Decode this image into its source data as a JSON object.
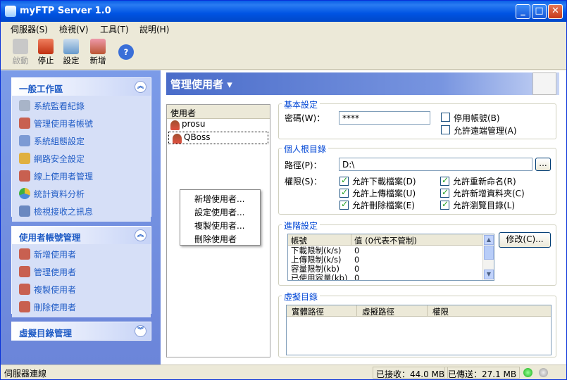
{
  "window": {
    "title": "myFTP Server 1.0"
  },
  "menu": [
    "伺服器(S)",
    "檢視(V)",
    "工具(T)",
    "說明(H)"
  ],
  "toolbar": {
    "start": "啟動",
    "stop": "停止",
    "settings": "設定",
    "add": "新增"
  },
  "sidebar": {
    "general": {
      "title": "一般工作區",
      "items": [
        "系統監看紀錄",
        "管理使用者帳號",
        "系統組態設定",
        "網路安全設定",
        "線上使用者管理",
        "統計資料分析",
        "檢視接收之訊息"
      ]
    },
    "accounts": {
      "title": "使用者帳號管理",
      "items": [
        "新增使用者",
        "管理使用者",
        "複製使用者",
        "刪除使用者"
      ]
    },
    "vdir": {
      "title": "虛擬目錄管理"
    }
  },
  "main": {
    "title": "管理使用者"
  },
  "users": {
    "header": "使用者",
    "list": [
      "prosu",
      "QBoss"
    ],
    "context_menu": [
      "新增使用者...",
      "設定使用者...",
      "複製使用者...",
      "刪除使用者"
    ]
  },
  "basic": {
    "legend": "基本設定",
    "password_label": "密碼(W)：",
    "password_value": "****",
    "disable": "停用帳號(B)",
    "remote": "允許遠端管理(A)"
  },
  "home": {
    "legend": "個人根目錄",
    "path_label": "路徑(P)：",
    "path_value": "D:\\",
    "browse": "...",
    "perm_label": "權限(S)：",
    "perms": [
      {
        "label": "允許下載檔案(D)",
        "checked": true
      },
      {
        "label": "允許重新命名(R)",
        "checked": true
      },
      {
        "label": "允許上傳檔案(U)",
        "checked": true
      },
      {
        "label": "允許新增資料夾(C)",
        "checked": true
      },
      {
        "label": "允許刪除檔案(E)",
        "checked": true
      },
      {
        "label": "允許瀏覽目錄(L)",
        "checked": true
      }
    ]
  },
  "advanced": {
    "legend": "進階設定",
    "col1": "帳號",
    "col2": "值 (0代表不管制)",
    "modify": "修改(C)...",
    "rows": [
      {
        "k": "下載限制(k/s)",
        "v": "0"
      },
      {
        "k": "上傳限制(k/s)",
        "v": "0"
      },
      {
        "k": "容量限制(kb)",
        "v": "0"
      },
      {
        "k": "已使用容量(kb)",
        "v": "0"
      }
    ]
  },
  "virtual": {
    "legend": "虛擬目錄",
    "cols": [
      "實體路徑",
      "虛擬路徑",
      "權限"
    ]
  },
  "status": {
    "state": "伺服器連線",
    "received": "已接收：44.0 MB",
    "sent": "已傳送：27.1 MB"
  }
}
